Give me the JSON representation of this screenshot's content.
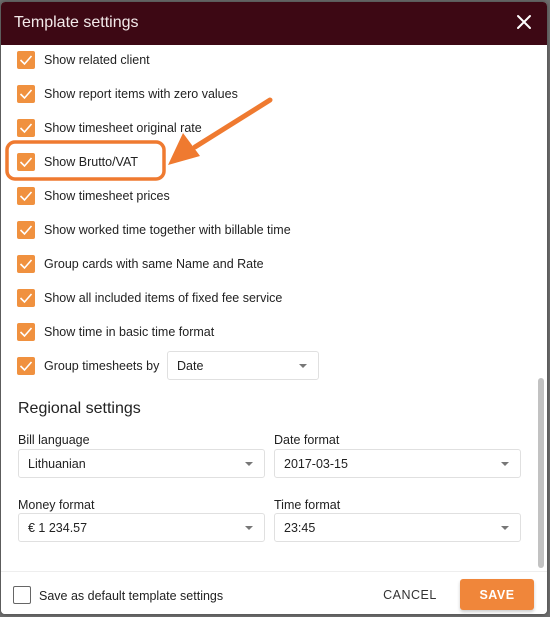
{
  "dialog": {
    "title": "Template settings",
    "close_icon": "close-icon"
  },
  "options": [
    {
      "label": "Show related client",
      "checked": true
    },
    {
      "label": "Show report items with zero values",
      "checked": true
    },
    {
      "label": "Show timesheet original rate",
      "checked": true
    },
    {
      "label": "Show Brutto/VAT",
      "checked": true,
      "highlighted": true
    },
    {
      "label": "Show timesheet prices",
      "checked": true
    },
    {
      "label": "Show worked time together with billable time",
      "checked": true
    },
    {
      "label": "Group cards with same Name and Rate",
      "checked": true
    },
    {
      "label": "Show all included items of fixed fee service",
      "checked": true
    },
    {
      "label": "Show time in basic time format",
      "checked": true
    },
    {
      "label": "Group timesheets by",
      "checked": true
    }
  ],
  "group_timesheets_select": {
    "value": "Date"
  },
  "regional": {
    "title": "Regional settings",
    "bill_language": {
      "label": "Bill language",
      "value": "Lithuanian"
    },
    "date_format": {
      "label": "Date format",
      "value": "2017-03-15"
    },
    "money_format": {
      "label": "Money format",
      "value": "€ 1 234.57"
    },
    "time_format": {
      "label": "Time format",
      "value": "23:45"
    }
  },
  "footer": {
    "default_label": "Save as default template settings",
    "default_checked": false,
    "cancel_label": "CANCEL",
    "save_label": "SAVE"
  },
  "colors": {
    "header_bg": "#3d0814",
    "accent": "#f0863a",
    "checkbox": "#f0913f",
    "annotation": "#ef7a30"
  }
}
